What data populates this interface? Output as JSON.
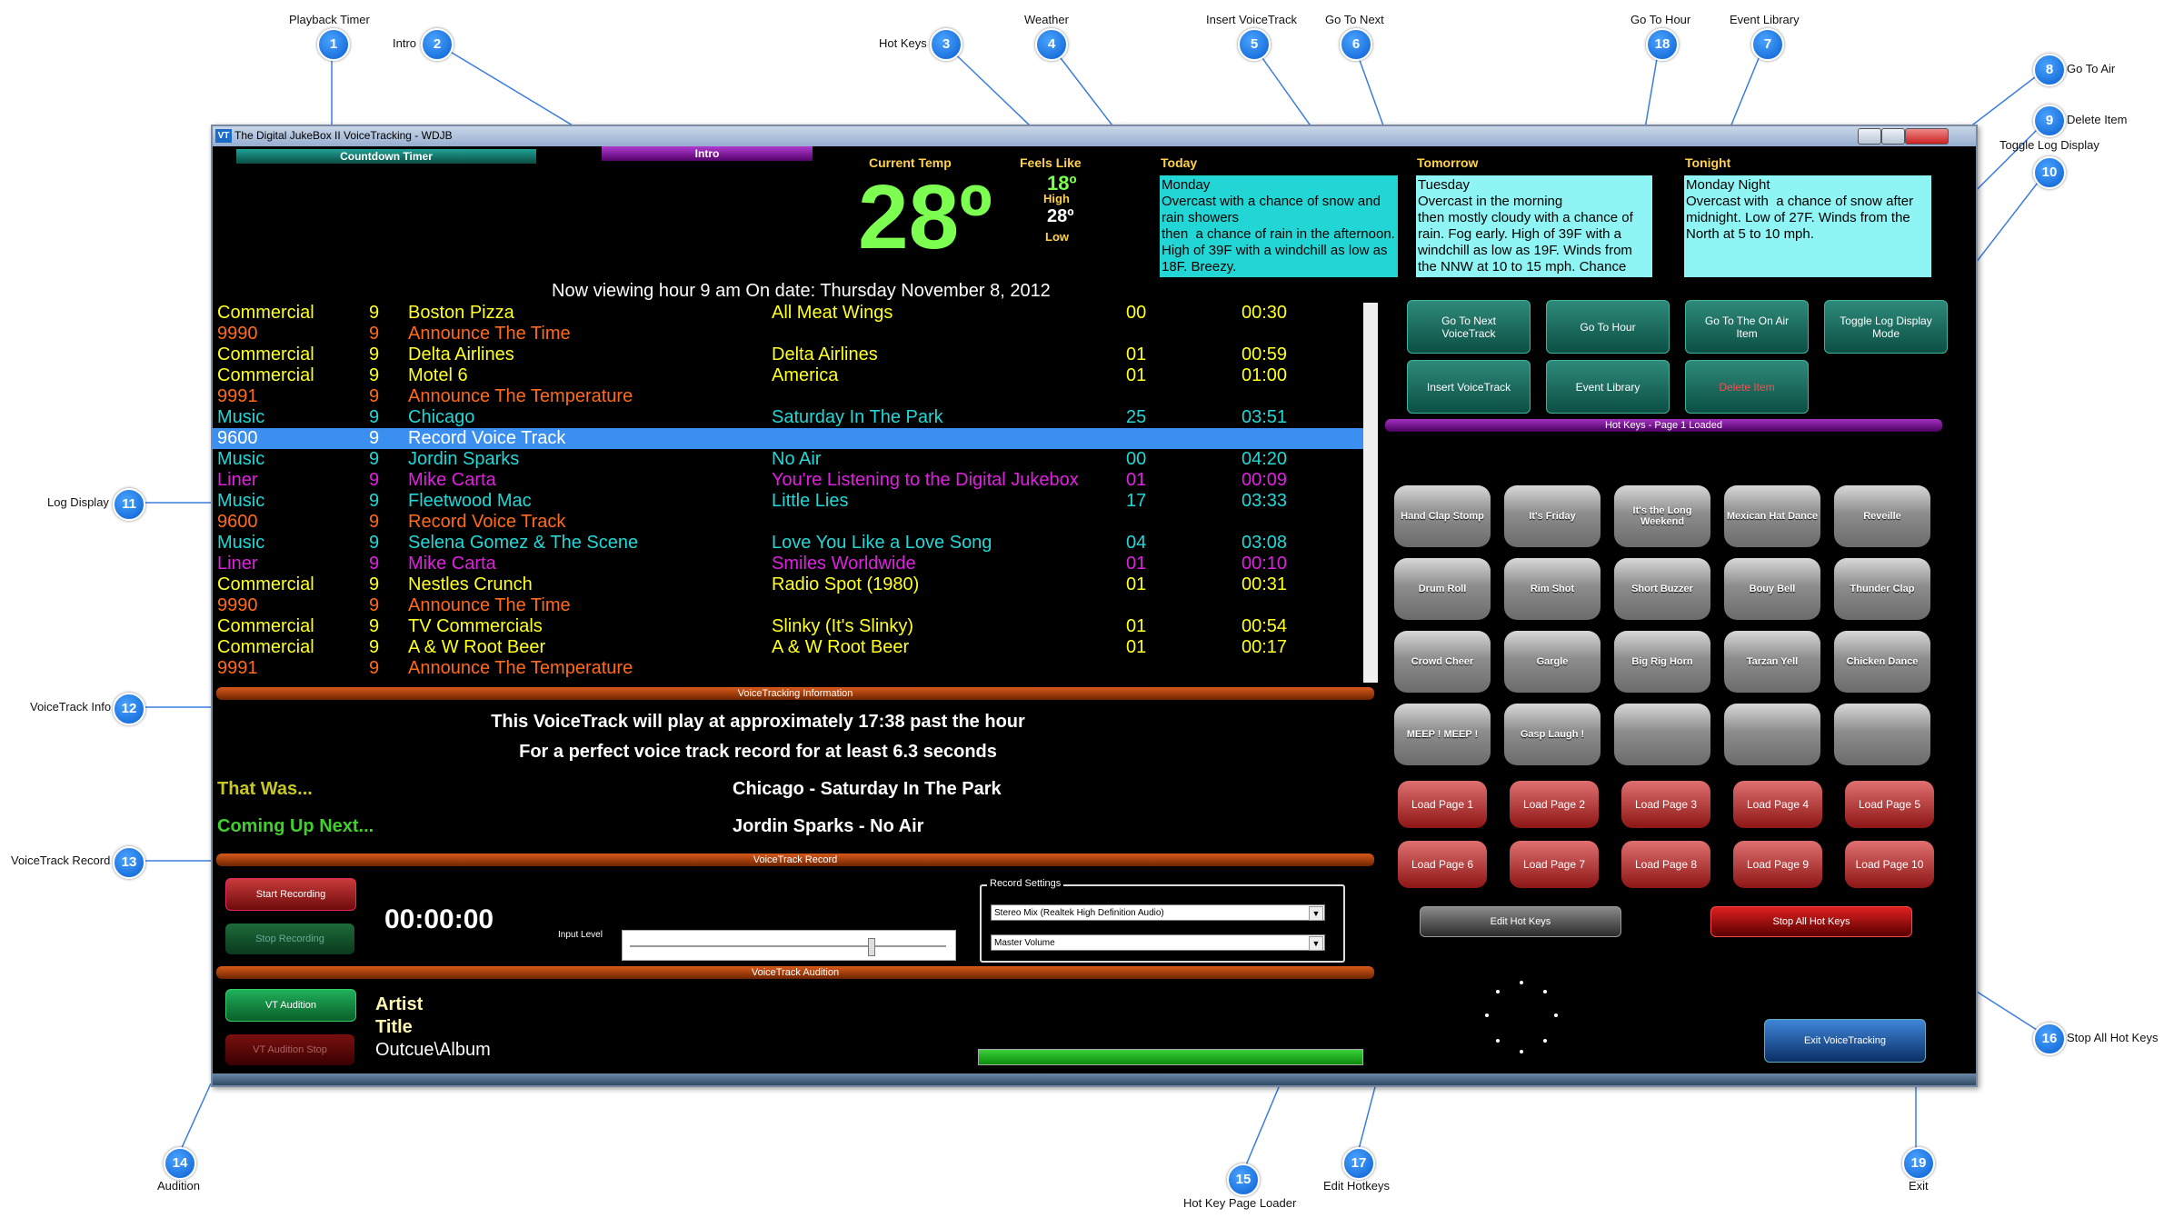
{
  "callouts": [
    {
      "num": "1",
      "label": "Playback Timer"
    },
    {
      "num": "2",
      "label": "Intro"
    },
    {
      "num": "3",
      "label": "Hot Keys"
    },
    {
      "num": "4",
      "label": "Weather"
    },
    {
      "num": "5",
      "label": "Insert VoiceTrack"
    },
    {
      "num": "6",
      "label": "Go To Next"
    },
    {
      "num": "18",
      "label": "Go To Hour"
    },
    {
      "num": "7",
      "label": "Event Library"
    },
    {
      "num": "8",
      "label": "Go To Air"
    },
    {
      "num": "9",
      "label": "Delete Item"
    },
    {
      "num": "10",
      "label": "Toggle Log Display"
    },
    {
      "num": "11",
      "label": "Log Display"
    },
    {
      "num": "12",
      "label": "VoiceTrack Info"
    },
    {
      "num": "13",
      "label": "VoiceTrack Record"
    },
    {
      "num": "14",
      "label": "Audition"
    },
    {
      "num": "15",
      "label": "Hot Key Page Loader"
    },
    {
      "num": "17",
      "label": "Edit Hotkeys"
    },
    {
      "num": "19",
      "label": "Exit"
    },
    {
      "num": "16",
      "label": "Stop All Hot Keys"
    }
  ],
  "window": {
    "icon": "VT",
    "title": "The Digital JukeBox II VoiceTracking - WDJB",
    "countdown_label": "Countdown Timer",
    "intro_label": "Intro"
  },
  "weather": {
    "current_temp_label": "Current Temp",
    "current_temp": "28º",
    "feels_like_label": "Feels Like",
    "feels_like": "18º",
    "high_label": "High",
    "high": "28º",
    "low_label": "Low",
    "today_label": "Today",
    "today_text": "Monday\nOvercast with a chance of snow and rain showers\nthen  a chance of rain in the afternoon. High of 39F with a windchill as low as 18F. Breezy.",
    "tomorrow_label": "Tomorrow",
    "tomorrow_text": "Tuesday\nOvercast in the morning\nthen mostly cloudy with a chance of rain. Fog early. High of 39F with a windchill as low as 19F. Winds from the NNW at 10 to 15 mph. Chance",
    "tonight_label": "Tonight",
    "tonight_text": "Monday Night\nOvercast with  a chance of snow after midnight. Low of 27F. Winds from the North at 5 to 10 mph."
  },
  "viewing_text": "Now viewing hour 9 am On date: Thursday November 8, 2012",
  "log": [
    {
      "type": "Commercial",
      "hour": "9",
      "title": "Boston Pizza",
      "sub": "All Meat Wings",
      "cat": "00",
      "time": "00:30",
      "style": "c-com"
    },
    {
      "type": "9990",
      "hour": "9",
      "title": "Announce The Time",
      "sub": "",
      "cat": "",
      "time": "",
      "style": "c-ann"
    },
    {
      "type": "Commercial",
      "hour": "9",
      "title": "Delta Airlines",
      "sub": "Delta Airlines",
      "cat": "01",
      "time": "00:59",
      "style": "c-com"
    },
    {
      "type": "Commercial",
      "hour": "9",
      "title": "Motel 6",
      "sub": "America",
      "cat": "01",
      "time": "01:00",
      "style": "c-com"
    },
    {
      "type": "9991",
      "hour": "9",
      "title": "Announce The Temperature",
      "sub": "",
      "cat": "",
      "time": "",
      "style": "c-ann"
    },
    {
      "type": "Music",
      "hour": "9",
      "title": "Chicago",
      "sub": "Saturday In The Park",
      "cat": "25",
      "time": "03:51",
      "style": "c-mus"
    },
    {
      "type": "9600",
      "hour": "9",
      "title": "Record Voice Track",
      "sub": "",
      "cat": "",
      "time": "",
      "style": "c-sel"
    },
    {
      "type": "Music",
      "hour": "9",
      "title": "Jordin Sparks",
      "sub": "No Air",
      "cat": "00",
      "time": "04:20",
      "style": "c-mus"
    },
    {
      "type": "Liner",
      "hour": "9",
      "title": "Mike Carta",
      "sub": "You're Listening to the Digital Jukebox",
      "cat": "01",
      "time": "00:09",
      "style": "c-liner"
    },
    {
      "type": "Music",
      "hour": "9",
      "title": "Fleetwood Mac",
      "sub": "Little Lies",
      "cat": "17",
      "time": "03:33",
      "style": "c-mus"
    },
    {
      "type": "9600",
      "hour": "9",
      "title": "Record Voice Track",
      "sub": "",
      "cat": "",
      "time": "",
      "style": "c-ann"
    },
    {
      "type": "Music",
      "hour": "9",
      "title": "Selena Gomez & The Scene",
      "sub": "Love You Like a Love Song",
      "cat": "04",
      "time": "03:08",
      "style": "c-mus"
    },
    {
      "type": "Liner",
      "hour": "9",
      "title": "Mike Carta",
      "sub": "Smiles Worldwide",
      "cat": "01",
      "time": "00:10",
      "style": "c-liner"
    },
    {
      "type": "Commercial",
      "hour": "9",
      "title": "Nestles Crunch",
      "sub": "Radio Spot (1980)",
      "cat": "01",
      "time": "00:31",
      "style": "c-com"
    },
    {
      "type": "9990",
      "hour": "9",
      "title": "Announce The Time",
      "sub": "",
      "cat": "",
      "time": "",
      "style": "c-ann"
    },
    {
      "type": "Commercial",
      "hour": "9",
      "title": "TV Commercials",
      "sub": "Slinky (It's Slinky)",
      "cat": "01",
      "time": "00:54",
      "style": "c-com"
    },
    {
      "type": "Commercial",
      "hour": "9",
      "title": "A & W Root Beer",
      "sub": "A & W Root Beer",
      "cat": "01",
      "time": "00:17",
      "style": "c-com"
    },
    {
      "type": "9991",
      "hour": "9",
      "title": "Announce The Temperature",
      "sub": "",
      "cat": "",
      "time": "",
      "style": "c-ann"
    }
  ],
  "nav_buttons": {
    "go_next": "Go To Next\nVoiceTrack",
    "go_hour": "Go To Hour",
    "go_air": "Go To The On Air\nItem",
    "toggle_log": "Toggle Log Display\nMode",
    "insert_vt": "Insert VoiceTrack",
    "event_library": "Event Library",
    "delete_item": "Delete Item"
  },
  "hotkeys_bar": "Hot Keys - Page  1 Loaded",
  "hotkeys": [
    "Hand Clap Stomp",
    "It's Friday",
    "It's the Long Weekend",
    "Mexican Hat Dance",
    "Reveille",
    "Drum Roll",
    "Rim Shot",
    "Short Buzzer",
    "Bouy Bell",
    "Thunder Clap",
    "Crowd Cheer",
    "Gargle",
    "Big Rig Horn",
    "Tarzan Yell",
    "Chicken Dance",
    "MEEP ! MEEP !",
    "Gasp Laugh !",
    "",
    "",
    ""
  ],
  "load_pages": [
    "Load Page 1",
    "Load Page 2",
    "Load Page 3",
    "Load Page 4",
    "Load Page 5",
    "Load Page 6",
    "Load Page 7",
    "Load Page 8",
    "Load Page 9",
    "Load Page 10"
  ],
  "edit_hot_keys": "Edit Hot Keys",
  "stop_all_hot_keys": "Stop All Hot Keys",
  "exit_vt": "Exit VoiceTracking",
  "vt_info": {
    "bar": "VoiceTracking Information",
    "line1": "This VoiceTrack will play at approximately 17:38 past the hour",
    "line2": "For a perfect voice track record for at least 6.3 seconds",
    "that_was_label": "That Was...",
    "that_was": "Chicago - Saturday In The Park",
    "coming_up_label": "Coming Up Next...",
    "coming_up": "Jordin Sparks - No Air"
  },
  "vt_record": {
    "bar": "VoiceTrack Record",
    "start": "Start Recording",
    "stop": "Stop Recording",
    "timer": "00:00:00",
    "input_level_label": "Input Level",
    "settings_label": "Record Settings",
    "device": "Stereo Mix (Realtek High Definition Audio)",
    "volume": "Master Volume"
  },
  "vt_audition": {
    "bar": "VoiceTrack Audition",
    "play": "VT Audition",
    "stop": "VT Audition Stop",
    "artist": "Artist",
    "title": "Title",
    "album": "Outcue\\Album",
    "progress": 1.0
  }
}
